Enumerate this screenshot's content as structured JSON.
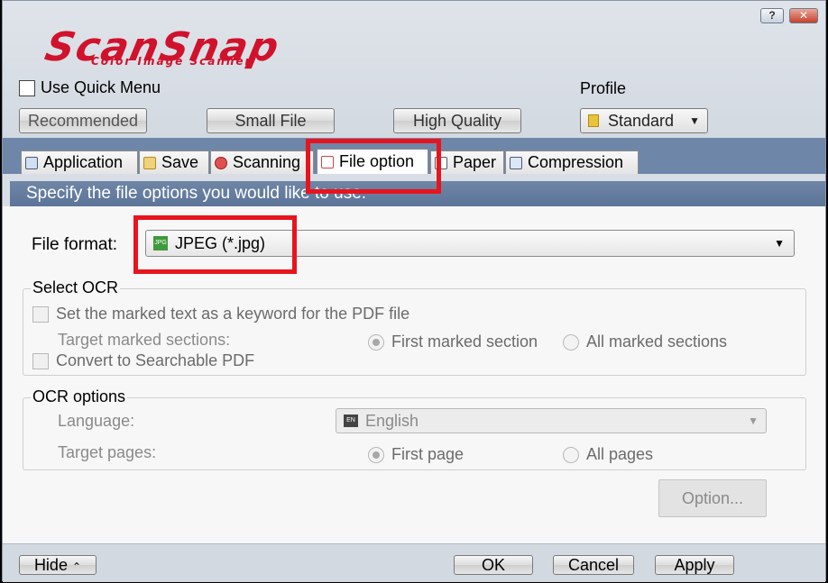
{
  "window": {
    "help_label": "?",
    "close_label": "✕"
  },
  "logo": {
    "main": "ScanSnap",
    "sub": "Color Image Scanner"
  },
  "header": {
    "quick_menu_label": "Use Quick Menu",
    "quick_menu_checked": false,
    "profile_label": "Profile",
    "profile_value": "Standard",
    "preset_buttons": [
      "Recommended",
      "Small File",
      "High Quality"
    ]
  },
  "tabs": [
    {
      "label": "Application",
      "icon": "application-icon"
    },
    {
      "label": "Save",
      "icon": "folder-icon"
    },
    {
      "label": "Scanning",
      "icon": "scan-icon"
    },
    {
      "label": "File option",
      "icon": "file-icon",
      "active": true
    },
    {
      "label": "Paper",
      "icon": "paper-icon"
    },
    {
      "label": "Compression",
      "icon": "compression-icon"
    }
  ],
  "banner": "Specify the file options you would like to use.",
  "file_format": {
    "label": "File format:",
    "value": "JPEG (*.jpg)",
    "icon_text": "JPG"
  },
  "select_ocr": {
    "title": "Select OCR",
    "keyword_label": "Set the marked text as a keyword for the PDF file",
    "target_label": "Target marked sections:",
    "first_marked": "First marked section",
    "all_marked": "All marked sections",
    "convert_label": "Convert to Searchable PDF"
  },
  "ocr_options": {
    "title": "OCR options",
    "language_label": "Language:",
    "language_value": "English",
    "language_icon_text": "EN",
    "target_pages_label": "Target pages:",
    "first_page": "First page",
    "all_pages": "All pages"
  },
  "option_button": "Option...",
  "bottom": {
    "hide": "Hide",
    "hide_glyph": "⌃",
    "ok": "OK",
    "cancel": "Cancel",
    "apply": "Apply"
  },
  "colors": {
    "annotation": "#e8141d",
    "tab_strip": "#6e86a8",
    "logo": "#d1122c"
  }
}
